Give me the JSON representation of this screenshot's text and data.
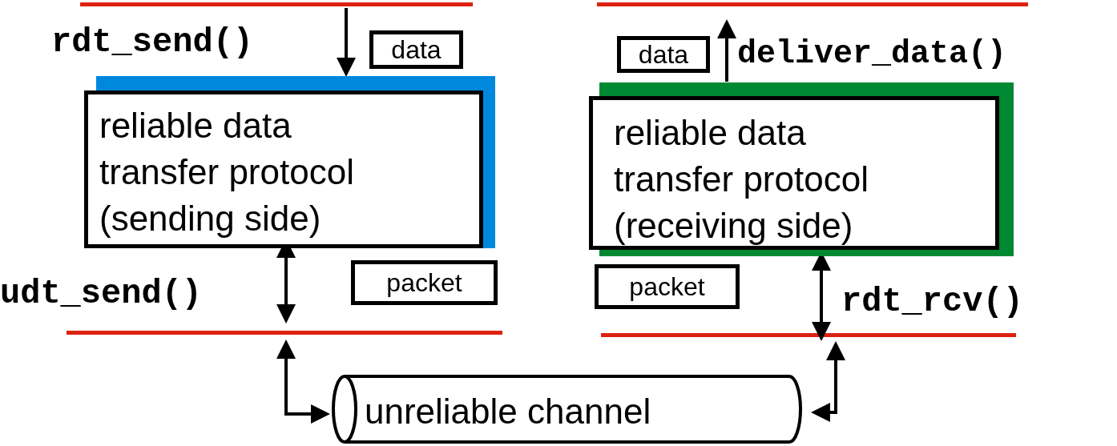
{
  "sides": [
    {
      "kind": "sender",
      "color": "#0088dd",
      "top_call": "rdt_send()",
      "top_label": "data",
      "protocol_lines": [
        "reliable data",
        "transfer protocol",
        "(sending side)"
      ],
      "bottom_call": "udt_send()",
      "bottom_label": "packet"
    },
    {
      "kind": "receiver",
      "color": "#008833",
      "top_call": "deliver_data()",
      "top_label": "data",
      "protocol_lines": [
        "reliable data",
        "transfer protocol",
        "(receiving side)"
      ],
      "bottom_call": "rdt_rcv()",
      "bottom_label": "packet"
    }
  ],
  "channel": {
    "label": "unreliable channel"
  }
}
